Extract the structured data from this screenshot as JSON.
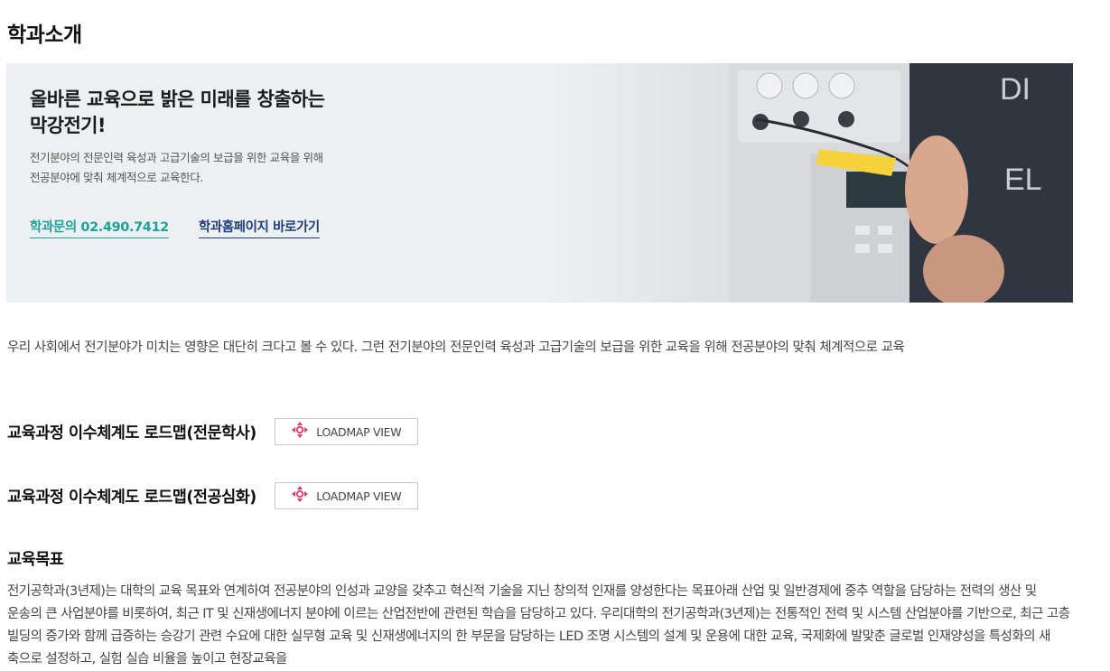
{
  "page": {
    "title": "학과소개"
  },
  "hero": {
    "heading_line1": "올바른 교육으로 밝은 미래를 창출하는",
    "heading_line2": "막강전기!",
    "desc_line1": "전기분야의 전문인력 육성과 고급기술의 보급을 위한 교육을 위해",
    "desc_line2": "전공분야에 맞춰 체계적으로 교육한다.",
    "phone_link": "학과문의 02.490.7412",
    "homepage_link": "학과홈페이지 바로가기",
    "photo_icon": "lab-equipment-photo"
  },
  "intro": {
    "text": "우리 사회에서 전기분야가 미치는 영향은 대단히 크다고 볼 수 있다. 그런 전기분야의 전문인력 육성과 고급기술의 보급을 위한 교육을 위해 전공분야의 맞춰 체계적으로 교육"
  },
  "roadmaps": [
    {
      "title": "교육과정 이수체계도 로드맵(전문학사)",
      "button_label": "LOADMAP VIEW",
      "button_icon": "move-arrows-icon"
    },
    {
      "title": "교육과정 이수체계도 로드맵(전공심화)",
      "button_label": "LOADMAP VIEW",
      "button_icon": "move-arrows-icon"
    }
  ],
  "goals": {
    "title": "교육목표",
    "text": "전기공학과(3년제)는 대학의 교육 목표와 연계하여 전공분야의 인성과 교양을 갖추고 혁신적 기술을 지닌 창의적 인재를 양성한다는 목표아래 산업 및 일반경제에 중추 역할을 담당하는 전력의 생산 및 운송의 큰 사업분야를 비롯하여, 최근 IT 및 신재생에너지 분야에 이르는 산업전반에 관련된 학습을 담당하고 있다. 우리대학의 전기공학과(3년제)는 전통적인 전력 및 시스템 산업분야를 기반으로, 최근 고층 빌딩의 증가와 함께 급증하는 승강기 관련 수요에 대한 실무형 교육 및 신재생에너지의 한 부문을 담당하는 LED 조명 시스템의 설계 및 운용에 대한 교육, 국제화에 발맞춘 글로벌 인재양성을 특성화의 새 축으로 설정하고, 실험 실습 비율을 높이고 현장교육을"
  },
  "colors": {
    "accent_teal": "#1ba39c",
    "accent_navy": "#1f3d78",
    "icon_pink": "#e8336d",
    "hero_bg": "#eeeff3"
  }
}
